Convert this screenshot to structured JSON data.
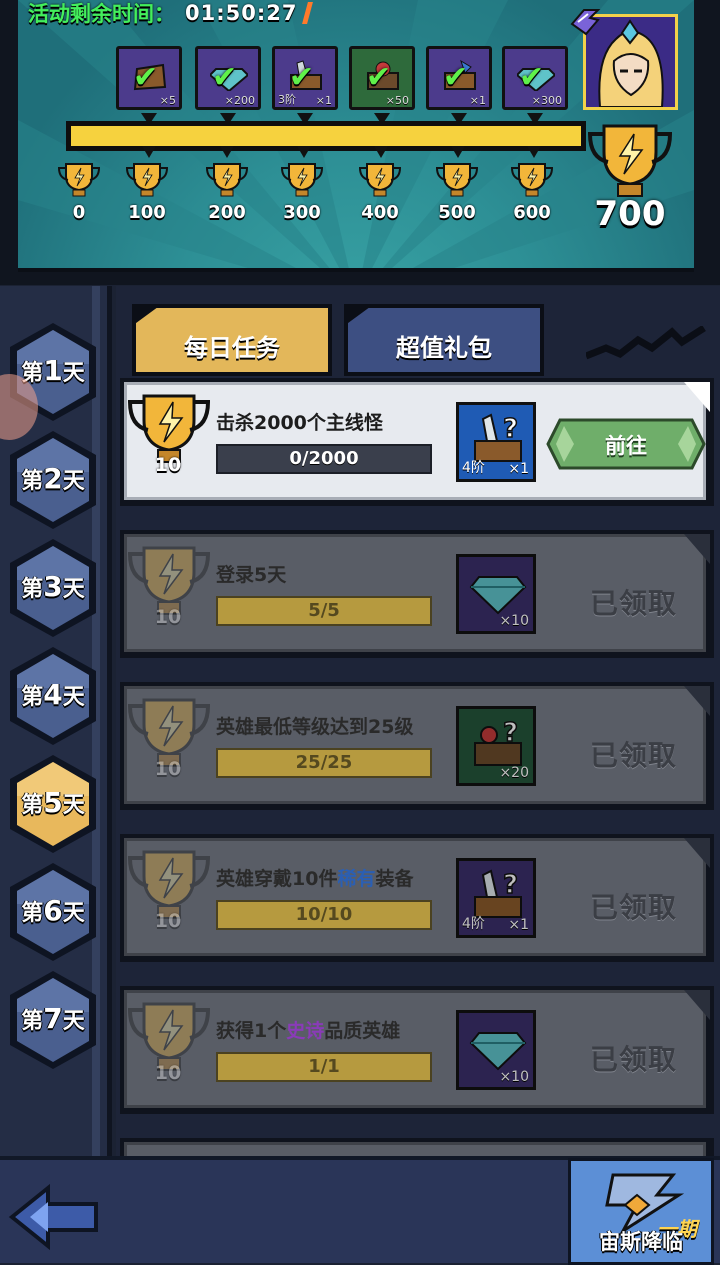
{
  "header": {
    "timer_label": "活动剩余时间：",
    "timer_value": "01:50:27",
    "score": "700",
    "progress_fraction": 1.0
  },
  "rewards": [
    {
      "name": "bag-icon",
      "count": "×5",
      "tier": "",
      "color": "purple",
      "claimed": true
    },
    {
      "name": "diamond-icon",
      "count": "×200",
      "tier": "",
      "color": "purple",
      "claimed": true
    },
    {
      "name": "equipment-chest-icon",
      "count": "×1",
      "tier": "3阶",
      "color": "purple",
      "claimed": true
    },
    {
      "name": "hero-chest-icon",
      "count": "×50",
      "tier": "",
      "color": "green",
      "claimed": true
    },
    {
      "name": "chest-icon",
      "count": "×1",
      "tier": "",
      "color": "purple",
      "claimed": true
    },
    {
      "name": "diamond-icon",
      "count": "×300",
      "tier": "",
      "color": "purple",
      "claimed": true
    }
  ],
  "milestones": [
    "0",
    "100",
    "200",
    "300",
    "400",
    "500",
    "600"
  ],
  "days": [
    {
      "prefix": "第",
      "num": "1",
      "suffix": "天",
      "active": false
    },
    {
      "prefix": "第",
      "num": "2",
      "suffix": "天",
      "active": false
    },
    {
      "prefix": "第",
      "num": "3",
      "suffix": "天",
      "active": false
    },
    {
      "prefix": "第",
      "num": "4",
      "suffix": "天",
      "active": false
    },
    {
      "prefix": "第",
      "num": "5",
      "suffix": "天",
      "active": true
    },
    {
      "prefix": "第",
      "num": "6",
      "suffix": "天",
      "active": false
    },
    {
      "prefix": "第",
      "num": "7",
      "suffix": "天",
      "active": false
    }
  ],
  "tabs": {
    "daily": "每日任务",
    "pack": "超值礼包"
  },
  "tasks": [
    {
      "points": "10",
      "title": "击杀2000个主线怪",
      "progress": "0/2000",
      "item_count": "×1",
      "item_tier": "4阶",
      "action": "前往",
      "claimed": false
    },
    {
      "points": "10",
      "title": "登录5天",
      "progress": "5/5",
      "item_count": "×10",
      "item_tier": "",
      "action": "已领取",
      "claimed": true
    },
    {
      "points": "10",
      "title": "英雄最低等级达到25级",
      "progress": "25/25",
      "item_count": "×20",
      "item_tier": "",
      "action": "已领取",
      "claimed": true
    },
    {
      "points": "10",
      "title_a": "英雄穿戴10件",
      "title_rare": "稀有",
      "title_b": "装备",
      "progress": "10/10",
      "item_count": "×1",
      "item_tier": "4阶",
      "action": "已领取",
      "claimed": true
    },
    {
      "points": "10",
      "title_a": "获得1个",
      "title_epic": "史诗",
      "title_b": "品质英雄",
      "progress": "1/1",
      "item_count": "×10",
      "item_tier": "",
      "action": "已领取",
      "claimed": true
    }
  ],
  "bottom": {
    "event_title": "宙斯降临",
    "event_sub": "一期"
  },
  "colors": {
    "accent_gold": "#f6d23e",
    "tab_active": "#e3b75a",
    "go_button": "#6fae6a",
    "timer_green": "#43ef5c"
  }
}
